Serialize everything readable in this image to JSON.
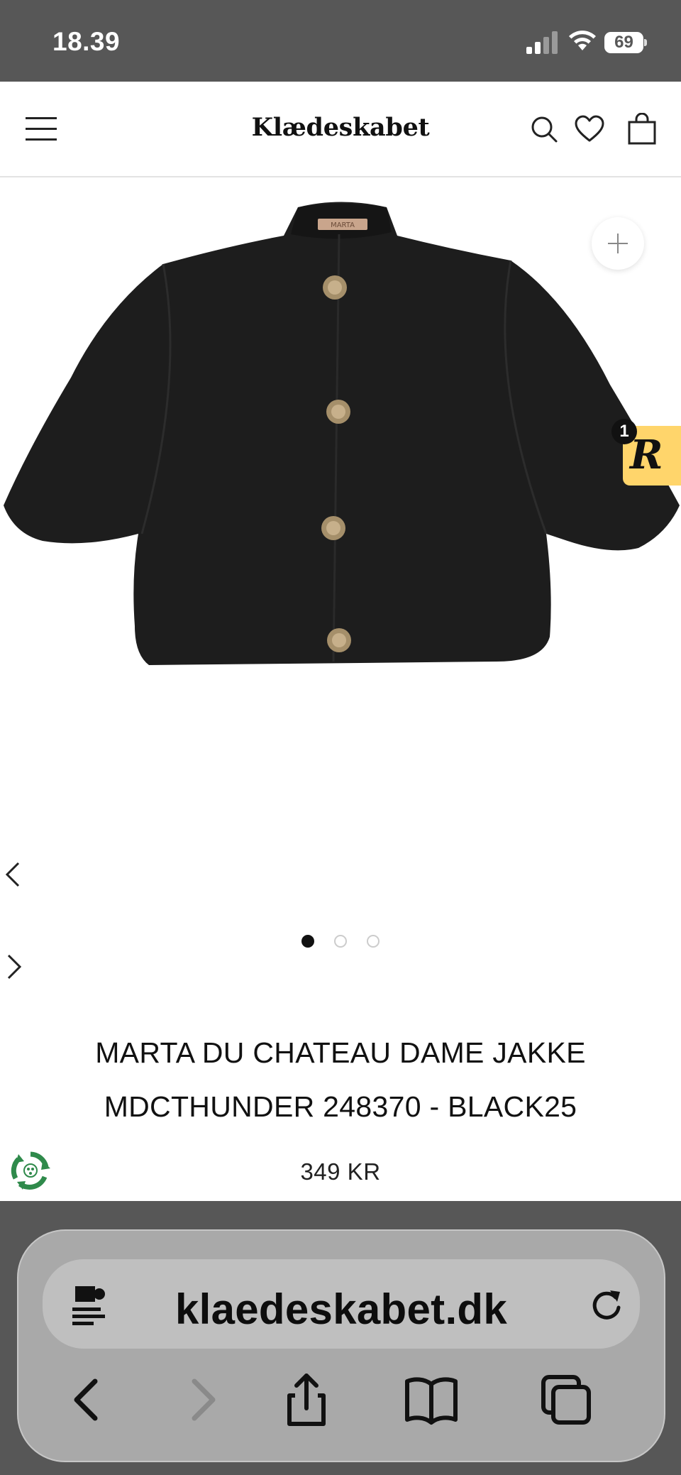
{
  "status_bar": {
    "time": "18.39",
    "battery": "69"
  },
  "header": {
    "logo": "Klædeskabet",
    "icons": [
      "menu-icon",
      "search-icon",
      "heart-icon",
      "bag-icon"
    ]
  },
  "gallery": {
    "slide_count": 3,
    "active_slide": 1,
    "image_brand_tag": "MARTA"
  },
  "rewards_badge": {
    "letter": "R",
    "count": "1"
  },
  "product": {
    "title_line1": "MARTA DU CHATEAU DAME JAKKE",
    "title_line2": "MDCTHUNDER 248370 - BLACK25",
    "price": "349 KR"
  },
  "browser": {
    "url": "klaedeskabet.dk"
  }
}
